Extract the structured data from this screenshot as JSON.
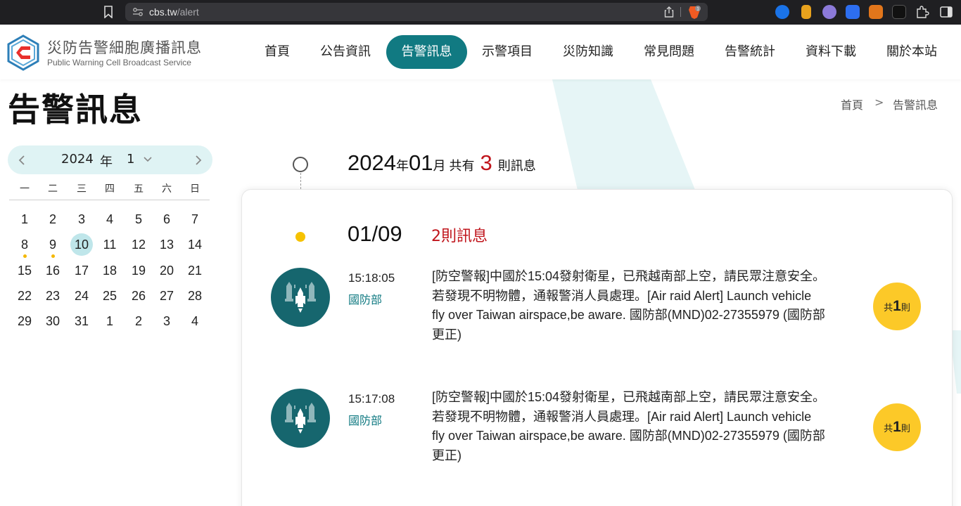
{
  "browser": {
    "url_host": "cbs.tw",
    "url_path": "/alert",
    "brave_badge": "1"
  },
  "site": {
    "title_zh": "災防告警細胞廣播訊息",
    "title_en": "Public Warning Cell Broadcast Service",
    "nav": [
      "首頁",
      "公告資訊",
      "告警訊息",
      "示警項目",
      "災防知識",
      "常見問題",
      "告警統計",
      "資料下載",
      "關於本站"
    ],
    "active_nav": "告警訊息"
  },
  "page": {
    "title": "告警訊息",
    "breadcrumb_home": "首頁",
    "breadcrumb_sep": ">",
    "breadcrumb_current": "告警訊息"
  },
  "calendar": {
    "year": "2024",
    "year_suffix": "年",
    "month": "1",
    "weekdays": [
      "一",
      "二",
      "三",
      "四",
      "五",
      "六",
      "日"
    ],
    "weeks": [
      [
        "1",
        "2",
        "3",
        "4",
        "5",
        "6",
        "7"
      ],
      [
        "8",
        "9",
        "10",
        "11",
        "12",
        "13",
        "14"
      ],
      [
        "15",
        "16",
        "17",
        "18",
        "19",
        "20",
        "21"
      ],
      [
        "22",
        "23",
        "24",
        "25",
        "26",
        "27",
        "28"
      ],
      [
        "29",
        "30",
        "31",
        "1",
        "2",
        "3",
        "4"
      ]
    ],
    "selected_day": "10",
    "days_with_alerts": [
      "8",
      "9"
    ],
    "dot_color": "#f4b800",
    "selected_color": "#bfe6ea"
  },
  "summary": {
    "year": "2024",
    "year_suffix": "年",
    "month": "01",
    "month_suffix": "月",
    "prefix": "共有",
    "count": "3",
    "suffix": "則訊息"
  },
  "day_group": {
    "date": "01/09",
    "count_text": "2則訊息"
  },
  "alerts": [
    {
      "time": "15:18:05",
      "agency": "國防部",
      "message": "[防空警報]中國於15:04發射衛星，已飛越南部上空，請民眾注意安全。若發現不明物體，通報警消人員處理。[Air raid Alert] Launch vehicle fly over Taiwan airspace,be aware. 國防部(MND)02-27355979 (國防部更正)",
      "badge_pre": "共",
      "badge_count": "1",
      "badge_post": "則",
      "icon": "missile-alert-icon"
    },
    {
      "time": "15:17:08",
      "agency": "國防部",
      "message": "[防空警報]中國於15:04發射衛星，已飛越南部上空，請民眾注意安全。若發現不明物體，通報警消人員處理。[Air raid Alert] Launch vehicle fly over Taiwan airspace,be aware. 國防部(MND)02-27355979 (國防部更正)",
      "badge_pre": "共",
      "badge_count": "1",
      "badge_post": "則",
      "icon": "missile-alert-icon"
    }
  ],
  "colors": {
    "brand_teal": "#117a82",
    "alert_red": "#c0151c",
    "badge_yellow": "#fcc928",
    "timeline_dot": "#f6c200"
  }
}
